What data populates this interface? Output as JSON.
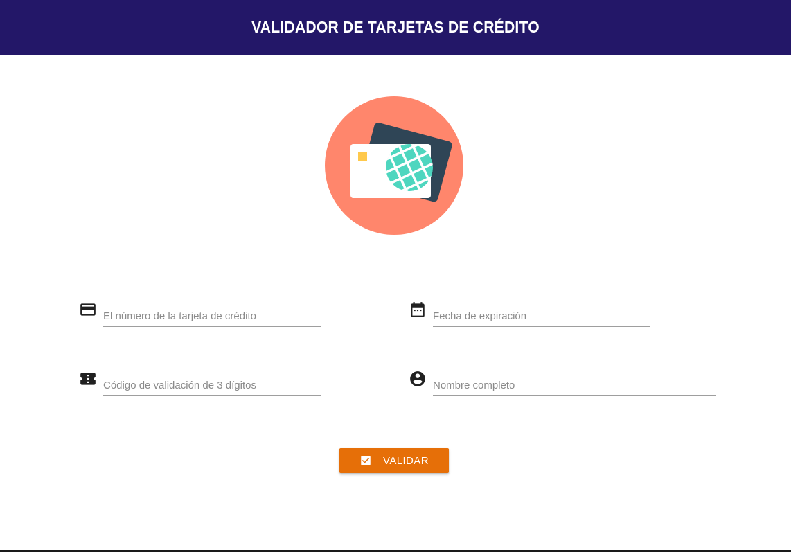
{
  "header": {
    "title": "VALIDADOR DE TARJETAS DE CRÉDITO"
  },
  "hero": {
    "icon": "credit-card-globe-icon",
    "circle_color": "#ff866c"
  },
  "form": {
    "card_number": {
      "placeholder": "El número de la tarjeta de crédito",
      "value": "",
      "icon": "credit-card-icon"
    },
    "expiration": {
      "placeholder": "Fecha de expiración",
      "value": "",
      "icon": "calendar-icon"
    },
    "cvv": {
      "placeholder": "Código de validación de 3 dígitos",
      "value": "",
      "icon": "ticket-icon"
    },
    "full_name": {
      "placeholder": "Nombre completo",
      "value": "",
      "icon": "account-circle-icon"
    }
  },
  "submit": {
    "label": "VALIDAR",
    "icon": "check-box-icon",
    "color": "#e66f08"
  },
  "theme": {
    "header_bg": "#231768"
  }
}
